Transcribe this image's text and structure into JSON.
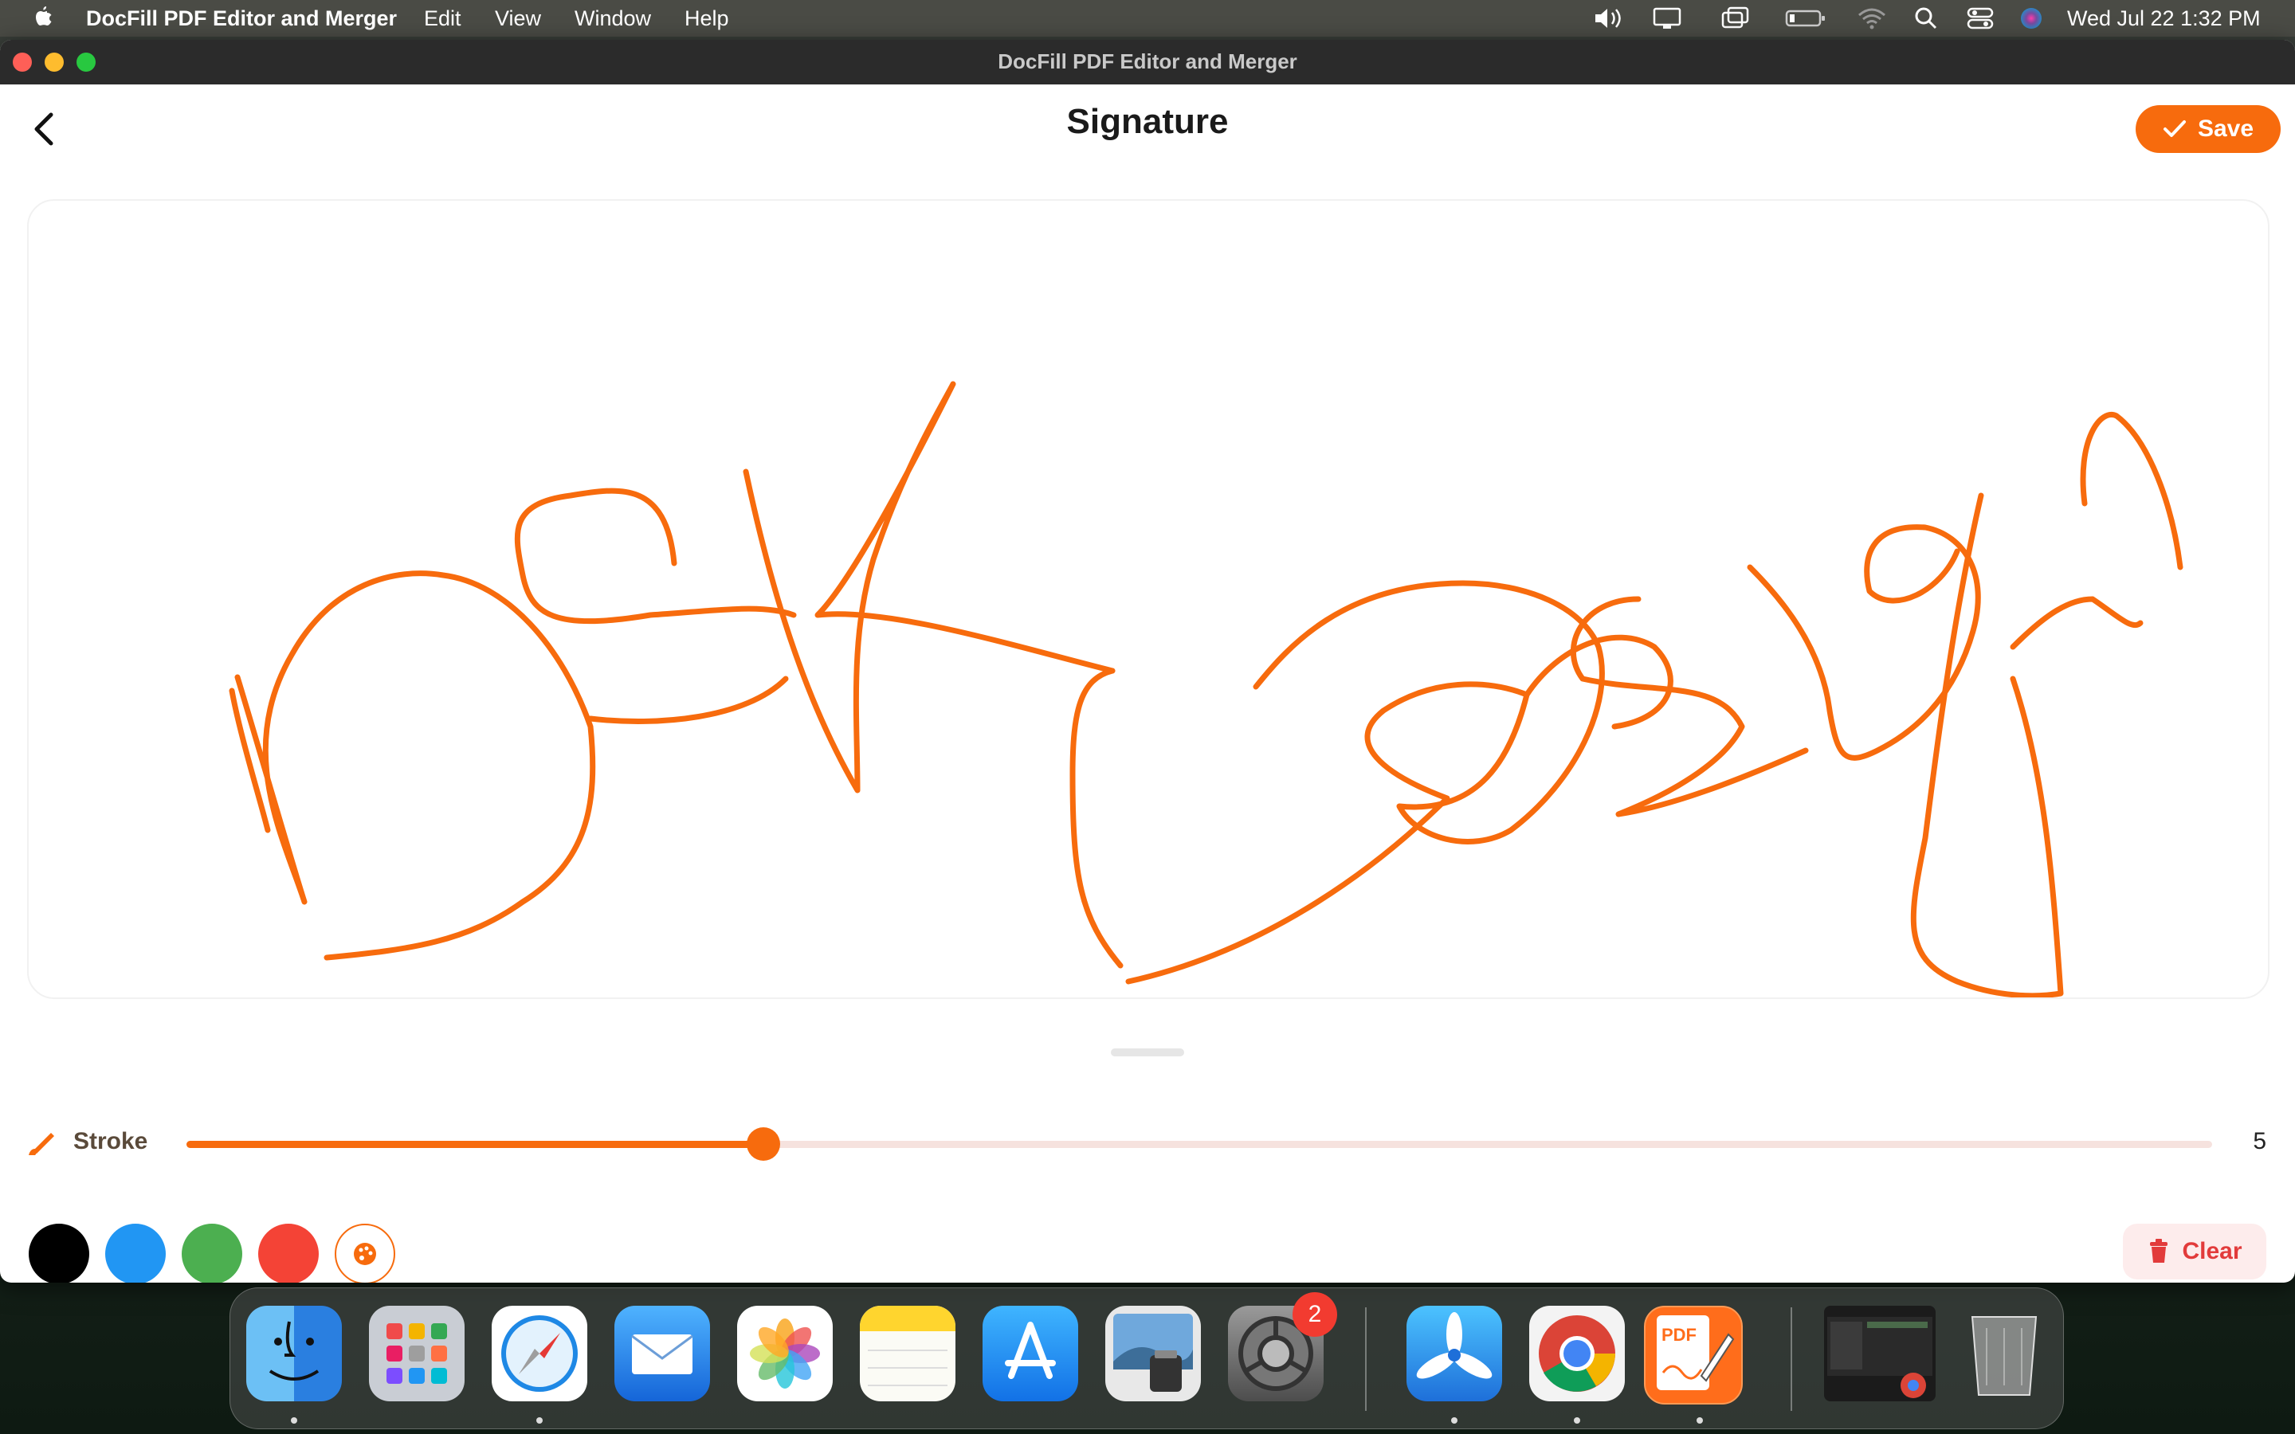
{
  "menubar": {
    "app_name": "DocFill PDF Editor and Merger",
    "menus": [
      "Edit",
      "View",
      "Window",
      "Help"
    ],
    "clock": "Wed Jul 22  1:32 PM",
    "status_icons": [
      "volume-icon",
      "display-icon",
      "screen-mirroring-icon",
      "battery-icon",
      "wifi-icon",
      "spotlight-icon",
      "control-center-icon",
      "siri-icon"
    ]
  },
  "window": {
    "title": "DocFill PDF Editor and Merger"
  },
  "header": {
    "title": "Signature",
    "save_label": "Save"
  },
  "stroke": {
    "label": "Stroke",
    "value": "5",
    "fill_fraction": 0.285
  },
  "colors": {
    "accent": "#F76B0D",
    "swatches": [
      {
        "name": "black",
        "hex": "#000000"
      },
      {
        "name": "blue",
        "hex": "#2196F3"
      },
      {
        "name": "green",
        "hex": "#4CAF50"
      },
      {
        "name": "red",
        "hex": "#F44336"
      }
    ],
    "clear_bg": "#FDECEC",
    "clear_text": "#E23B3B"
  },
  "actions": {
    "clear_label": "Clear"
  },
  "dock": {
    "apps": [
      "Finder",
      "Launchpad",
      "Safari",
      "Mail",
      "Photos",
      "Notes",
      "App Store",
      "Preview",
      "System Preferences",
      "TestFlight",
      "Google Chrome",
      "DocFill PDF Editor and Merger",
      "Chrome window",
      "Trash"
    ],
    "settings_badge": "2",
    "docfill_icon_text": "PDF"
  }
}
